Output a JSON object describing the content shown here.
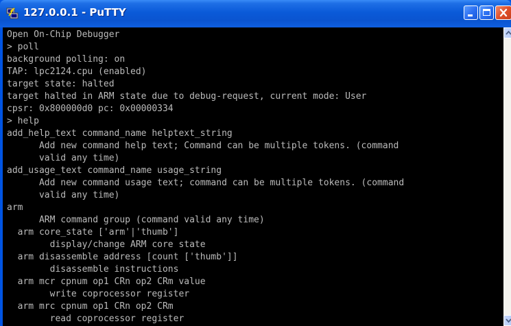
{
  "window": {
    "title": "127.0.0.1 - PuTTY",
    "icon": "putty-icon"
  },
  "titlebar_buttons": {
    "minimize_icon": "minimize-icon",
    "maximize_icon": "maximize-icon",
    "close_icon": "close-icon"
  },
  "terminal": {
    "lines": [
      "Open On-Chip Debugger",
      "> poll",
      "background polling: on",
      "TAP: lpc2124.cpu (enabled)",
      "target state: halted",
      "target halted in ARM state due to debug-request, current mode: User",
      "cpsr: 0x800000d0 pc: 0x00000334",
      "> help",
      "add_help_text command_name helptext_string",
      "      Add new command help text; Command can be multiple tokens. (command",
      "      valid any time)",
      "add_usage_text command_name usage_string",
      "      Add new command usage text; command can be multiple tokens. (command",
      "      valid any time)",
      "arm",
      "      ARM command group (command valid any time)",
      "  arm core_state ['arm'|'thumb']",
      "        display/change ARM core state",
      "  arm disassemble address [count ['thumb']]",
      "        disassemble instructions",
      "  arm mcr cpnum op1 CRn op2 CRm value",
      "        write coprocessor register",
      "  arm mrc cpnum op1 CRn op2 CRm",
      "        read coprocessor register"
    ],
    "text_color": "#bbbbbb",
    "background_color": "#000000"
  },
  "scrollbar": {
    "up_icon": "scroll-up-arrow-icon",
    "down_icon": "scroll-down-arrow-icon"
  }
}
